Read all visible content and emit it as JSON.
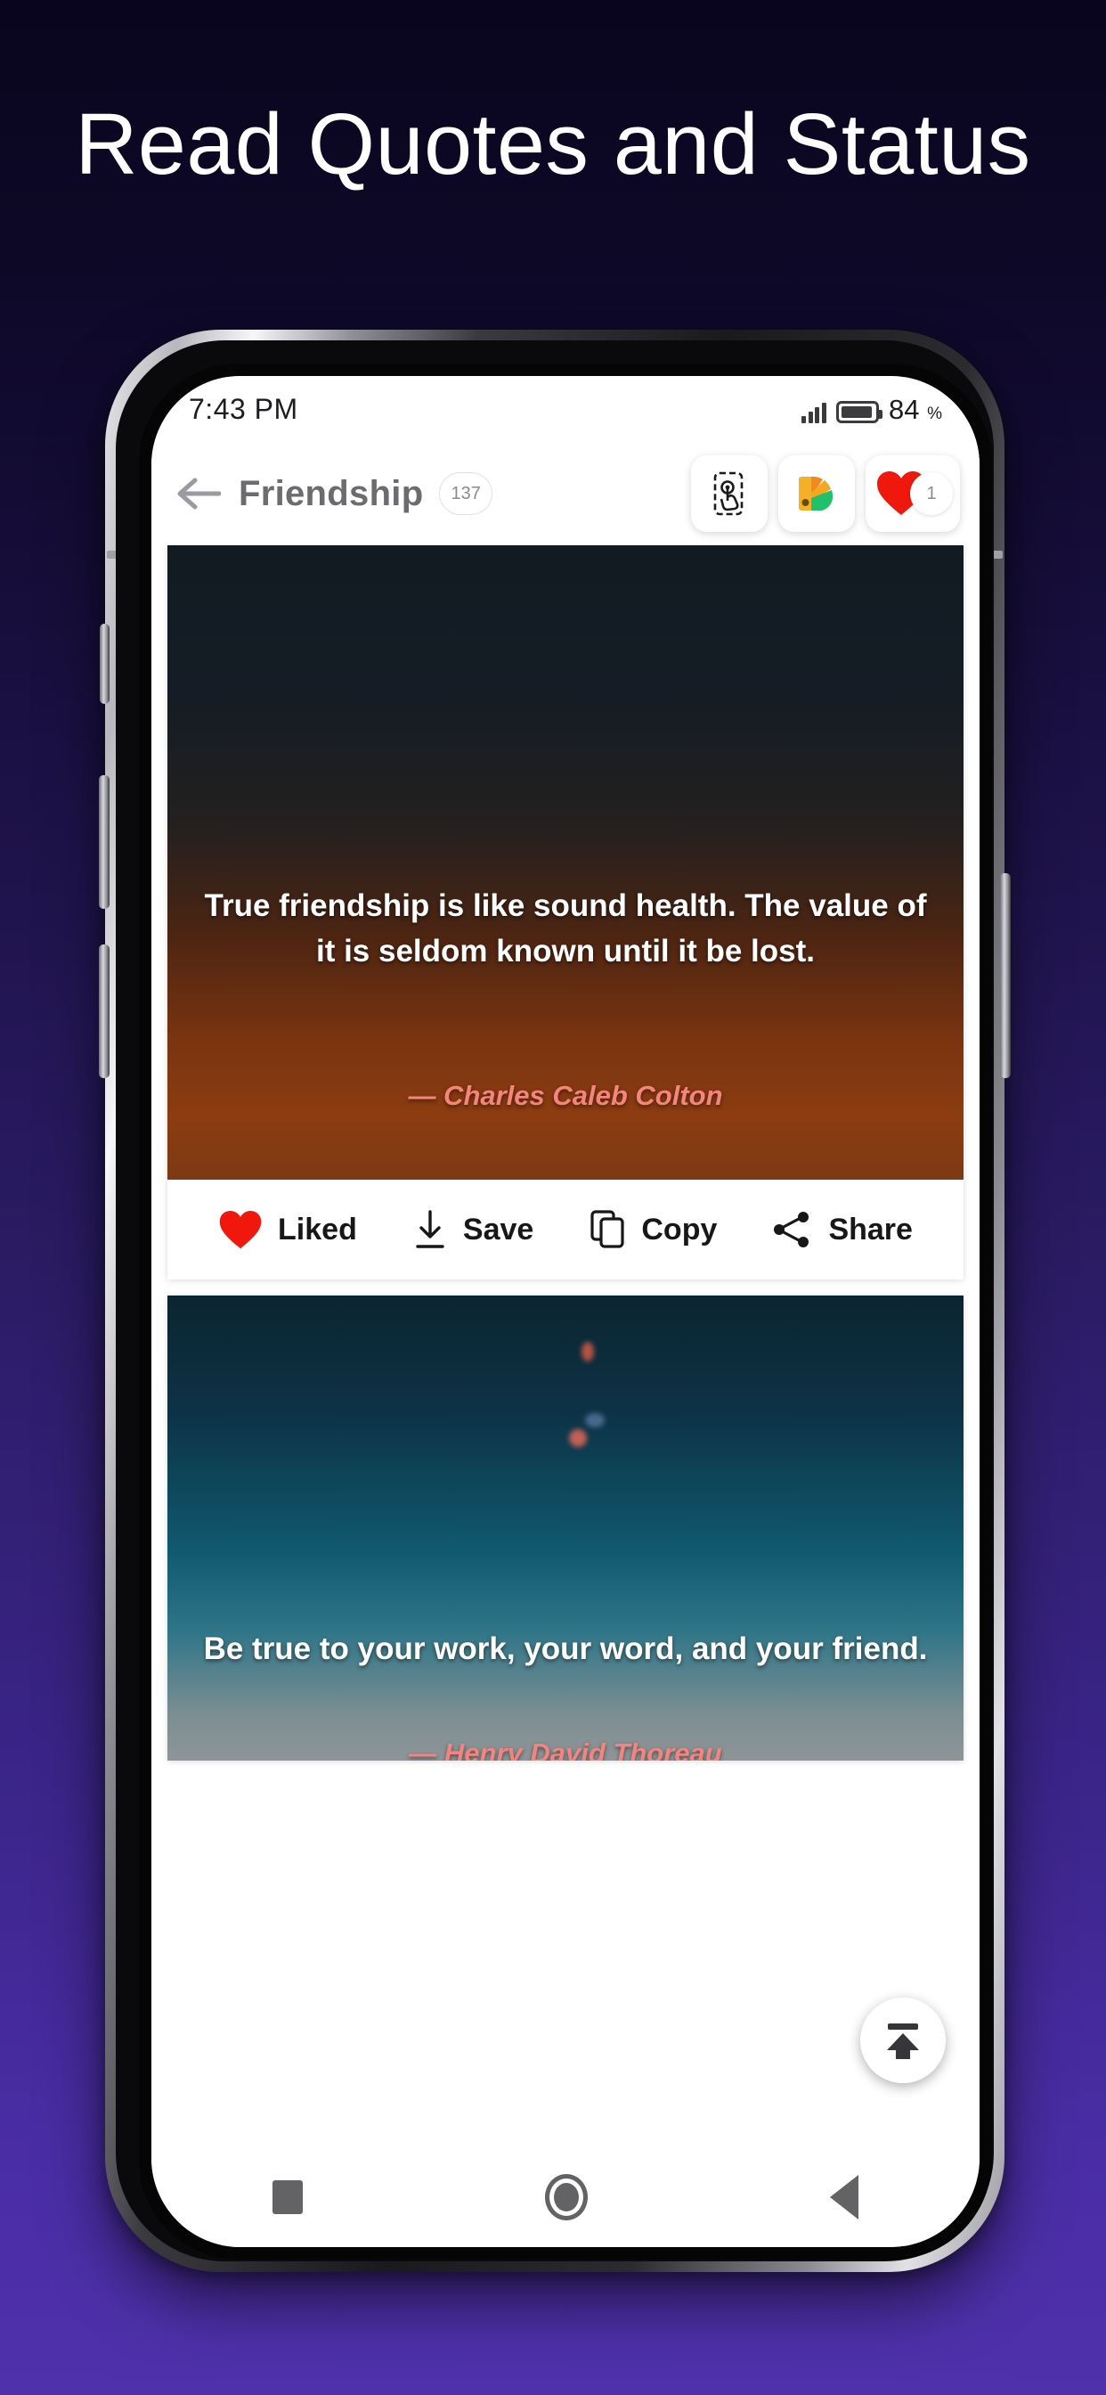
{
  "headline": "Read Quotes and Status",
  "theme": {
    "bg_top": "#09051e",
    "bg_bottom": "#4f31ab",
    "accent_red": "#f0180c",
    "author_color": "#f4847e"
  },
  "status_bar": {
    "time": "7:43 PM",
    "battery_percent": "84",
    "percent_symbol": "%",
    "signal_icon": "signal-bars-icon",
    "battery_icon": "battery-icon"
  },
  "app_bar": {
    "back_icon": "back-arrow-icon",
    "title": "Friendship",
    "count": "137",
    "actions": [
      {
        "icon": "tap-phone-icon",
        "name": "set-as-status-button"
      },
      {
        "icon": "color-palette-icon",
        "name": "theme-button"
      },
      {
        "icon": "heart-icon",
        "name": "favorites-button",
        "badge": "1"
      }
    ]
  },
  "quotes": [
    {
      "text": "True friendship is like sound health. The value of it is seldom known until it be lost.",
      "author": "— Charles Caleb Colton",
      "actions": [
        {
          "icon": "heart-filled-icon",
          "label": "Liked"
        },
        {
          "icon": "download-icon",
          "label": "Save"
        },
        {
          "icon": "copy-icon",
          "label": "Copy"
        },
        {
          "icon": "share-icon",
          "label": "Share"
        }
      ]
    },
    {
      "text": "Be true to your work, your word, and your friend.",
      "author": "— Henry David Thoreau"
    }
  ],
  "fab": {
    "icon": "upload-icon",
    "name": "upload-button"
  },
  "nav_bar": {
    "recents": "recents-square-icon",
    "home": "home-circle-icon",
    "back": "back-triangle-icon"
  }
}
